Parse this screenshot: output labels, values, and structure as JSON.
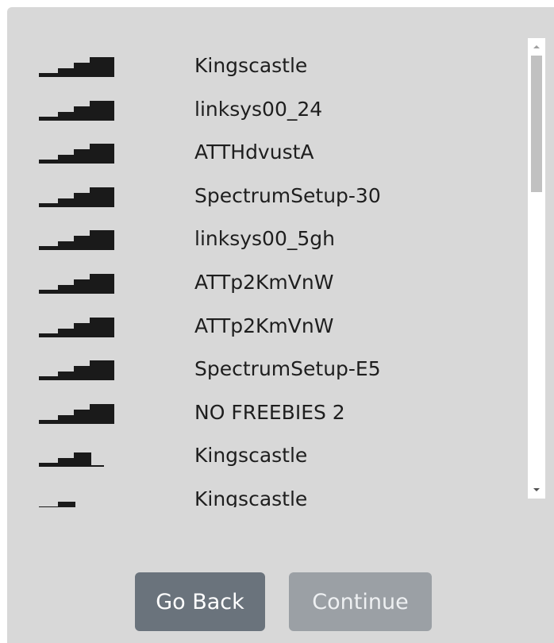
{
  "networks": [
    {
      "name": "Kingscastle",
      "signal": 4
    },
    {
      "name": "linksys00_24",
      "signal": 4
    },
    {
      "name": "ATTHdvustA",
      "signal": 4
    },
    {
      "name": "SpectrumSetup-30",
      "signal": 4
    },
    {
      "name": "linksys00_5gh",
      "signal": 4
    },
    {
      "name": "ATTp2KmVnW",
      "signal": 4
    },
    {
      "name": "ATTp2KmVnW",
      "signal": 4
    },
    {
      "name": "SpectrumSetup-E5",
      "signal": 4
    },
    {
      "name": "NO FREEBIES 2",
      "signal": 4
    },
    {
      "name": "Kingscastle",
      "signal": 3
    },
    {
      "name": "Kingscastle",
      "signal": 2
    }
  ],
  "buttons": {
    "back_label": "Go Back",
    "continue_label": "Continue"
  },
  "colors": {
    "panel_bg": "#d8d8d8",
    "icon_fill": "#1a1a1a",
    "back_button": "#6a737c",
    "continue_button_disabled": "#9ba0a5"
  }
}
